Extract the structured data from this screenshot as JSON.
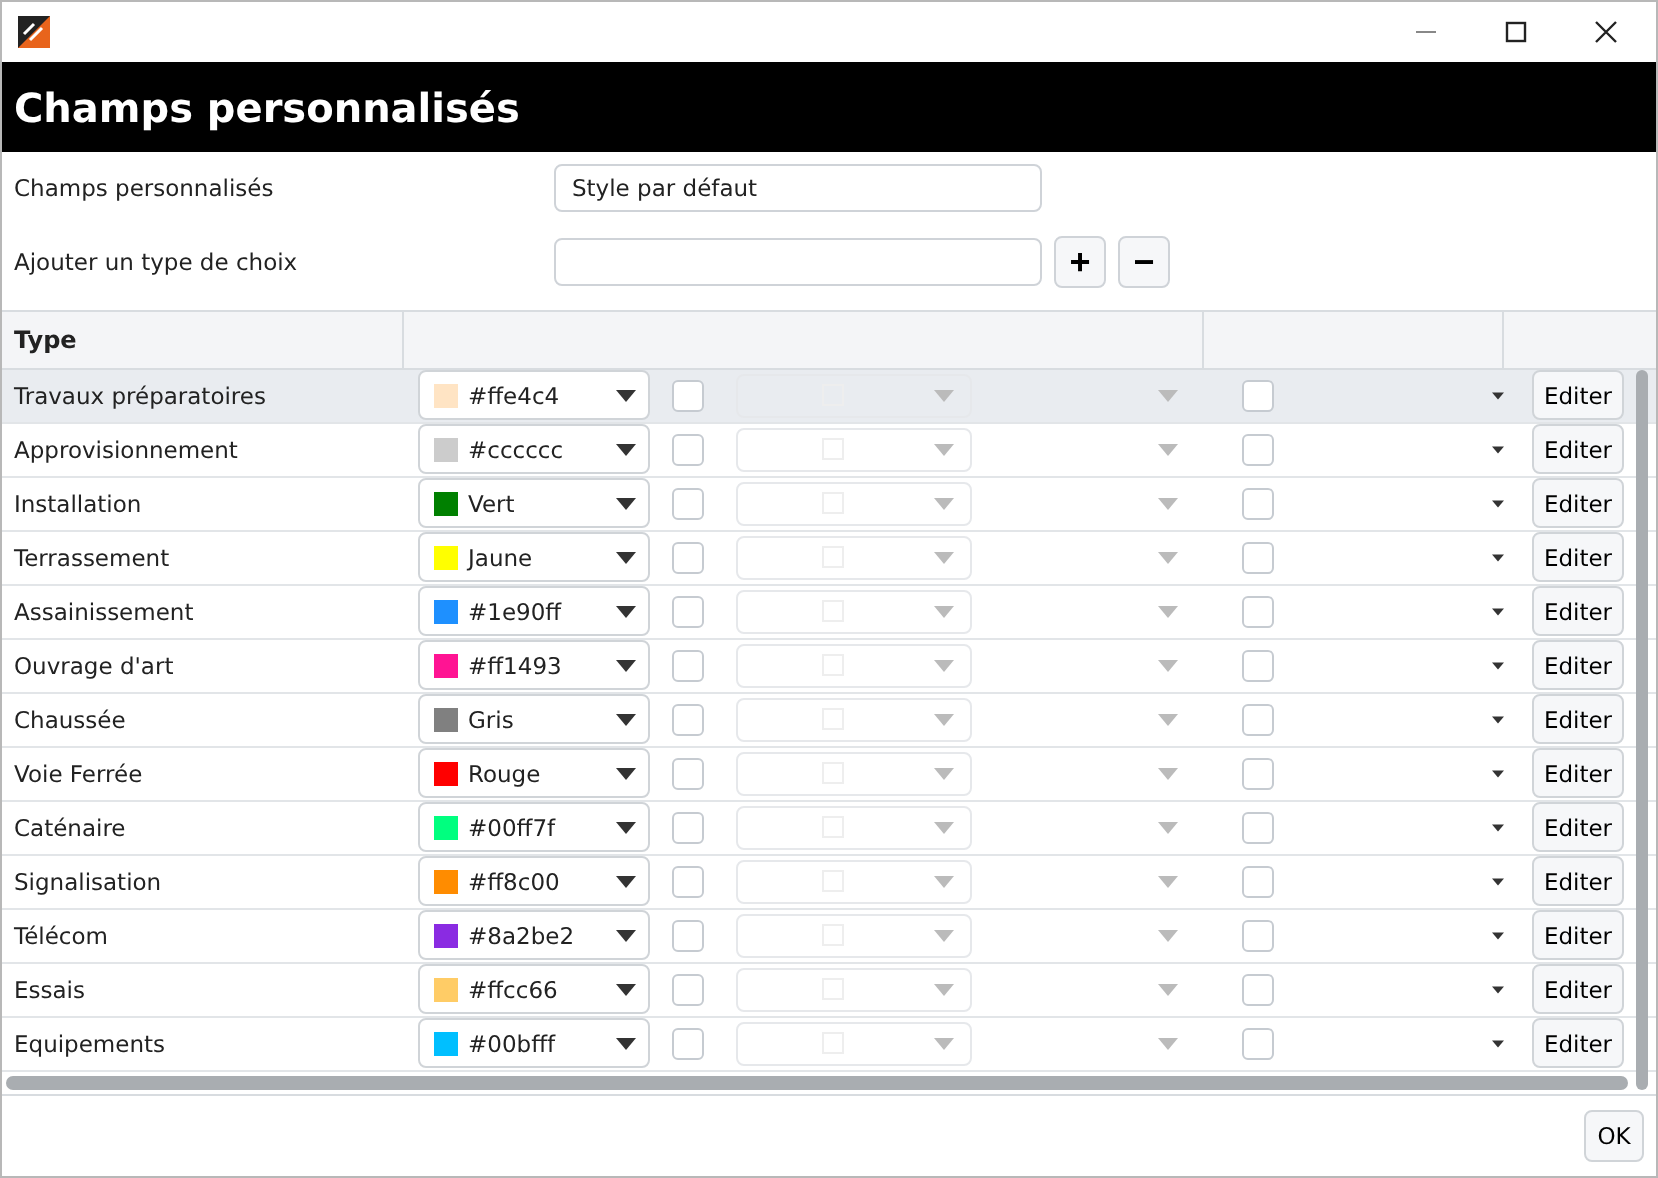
{
  "header": {
    "title": "Champs personnalisés"
  },
  "form": [
    {
      "label": "Champs personnalisés",
      "value": "Style par défaut"
    },
    {
      "label": "Ajouter un type de choix"
    }
  ],
  "add_buttons": [
    "+",
    "−"
  ],
  "table": {
    "columns": [
      "Type"
    ],
    "rows": [
      {
        "name": "Travaux préparatoires",
        "color": "#ffe4c4",
        "color_label": "#ffe4c4",
        "check_a": false,
        "check_b": false,
        "selected": true
      },
      {
        "name": "Approvisionnement",
        "color": "#cccccc",
        "color_label": "#cccccc",
        "check_a": false,
        "check_b": false,
        "selected": false
      },
      {
        "name": "Installation",
        "color": "#008000",
        "color_label": "Vert",
        "check_a": false,
        "check_b": false,
        "selected": false
      },
      {
        "name": "Terrassement",
        "color": "#ffff00",
        "color_label": "Jaune",
        "check_a": false,
        "check_b": false,
        "selected": false
      },
      {
        "name": "Assainissement",
        "color": "#1e90ff",
        "color_label": "#1e90ff",
        "check_a": false,
        "check_b": false,
        "selected": false
      },
      {
        "name": "Ouvrage d'art",
        "color": "#ff1493",
        "color_label": "#ff1493",
        "check_a": false,
        "check_b": false,
        "selected": false
      },
      {
        "name": "Chaussée",
        "color": "#808080",
        "color_label": "Gris",
        "check_a": false,
        "check_b": false,
        "selected": false
      },
      {
        "name": "Voie Ferrée",
        "color": "#ff0000",
        "color_label": "Rouge",
        "check_a": false,
        "check_b": false,
        "selected": false
      },
      {
        "name": "Caténaire",
        "color": "#00ff7f",
        "color_label": "#00ff7f",
        "check_a": false,
        "check_b": false,
        "selected": false
      },
      {
        "name": "Signalisation",
        "color": "#ff8c00",
        "color_label": "#ff8c00",
        "check_a": false,
        "check_b": false,
        "selected": false
      },
      {
        "name": "Télécom",
        "color": "#8a2be2",
        "color_label": "#8a2be2",
        "check_a": false,
        "check_b": false,
        "selected": false
      },
      {
        "name": "Essais",
        "color": "#ffcc66",
        "color_label": "#ffcc66",
        "check_a": false,
        "check_b": false,
        "selected": false
      },
      {
        "name": "Equipements",
        "color": "#00bfff",
        "color_label": "#00bfff",
        "check_a": false,
        "check_b": false,
        "selected": false
      }
    ],
    "row_buttons": [
      "Editer",
      "Editer",
      "Editer",
      "Editer",
      "Editer",
      "Editer",
      "Editer",
      "Editer",
      "Editer",
      "Editer",
      "Editer",
      "Editer",
      "Editer"
    ]
  },
  "footer_button": "OK"
}
